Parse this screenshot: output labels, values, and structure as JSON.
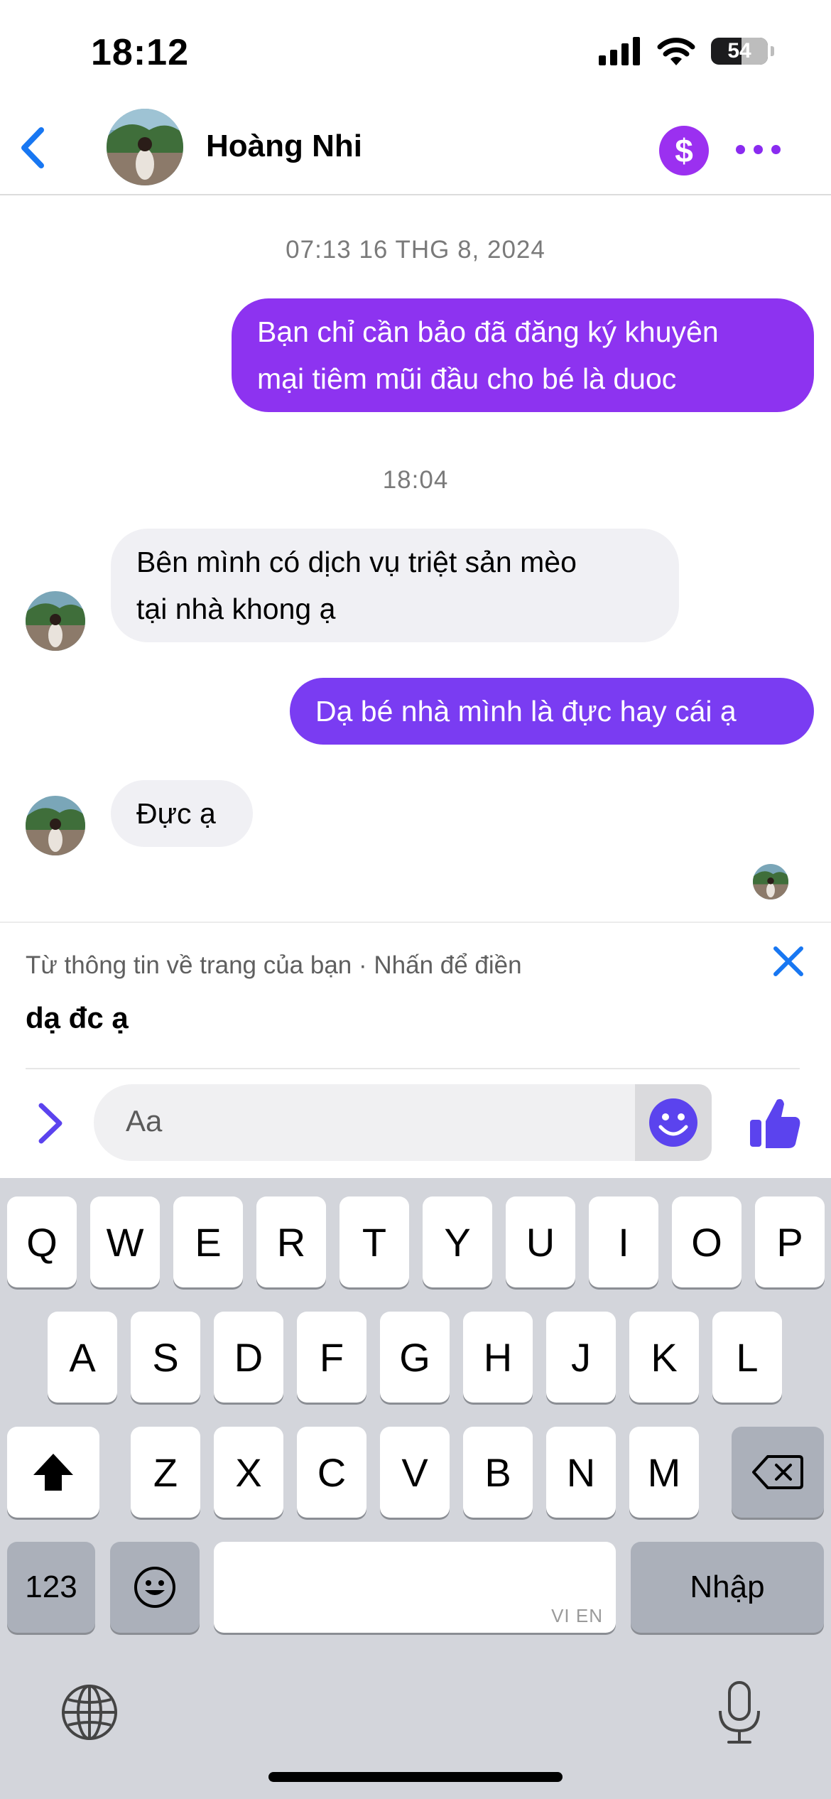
{
  "status_bar": {
    "time": "18:12",
    "battery": "54"
  },
  "header": {
    "contact_name": "Hoàng Nhi",
    "pay_symbol": "$"
  },
  "messages": [
    {
      "type": "timestamp",
      "text": "07:13 16 THG 8, 2024"
    },
    {
      "type": "outgoing",
      "lines": [
        "Bạn chỉ cần bảo đã đăng ký khuyên",
        "mại tiêm mũi đầu cho bé là duoc"
      ]
    },
    {
      "type": "timestamp",
      "text": "18:04"
    },
    {
      "type": "incoming",
      "lines": [
        "Bên mình có dịch vụ triệt sản mèo",
        "tại nhà khong ạ"
      ]
    },
    {
      "type": "outgoing",
      "lines": [
        "Dạ bé nhà mình là đực hay cái ạ"
      ]
    },
    {
      "type": "incoming",
      "lines": [
        "Đực ạ"
      ]
    }
  ],
  "suggestion": {
    "label": "Từ thông tin về trang của bạn · Nhấn để điền",
    "text": "dạ đc ạ"
  },
  "composer": {
    "placeholder": "Aa"
  },
  "keyboard": {
    "row1": [
      "Q",
      "W",
      "E",
      "R",
      "T",
      "Y",
      "U",
      "I",
      "O",
      "P"
    ],
    "row2": [
      "A",
      "S",
      "D",
      "F",
      "G",
      "H",
      "J",
      "K",
      "L"
    ],
    "row3": [
      "Z",
      "X",
      "C",
      "V",
      "B",
      "N",
      "M"
    ],
    "numbers_key": "123",
    "return_key": "Nhập",
    "space_hint": "VI EN"
  },
  "colors": {
    "outgoing_bubble_1": "#8d33f0",
    "outgoing_bubble_2": "#7a3cf2",
    "incoming_bubble": "#f0f0f4",
    "accent_blue": "#1877f2",
    "messenger_purple": "#5b43ee"
  }
}
